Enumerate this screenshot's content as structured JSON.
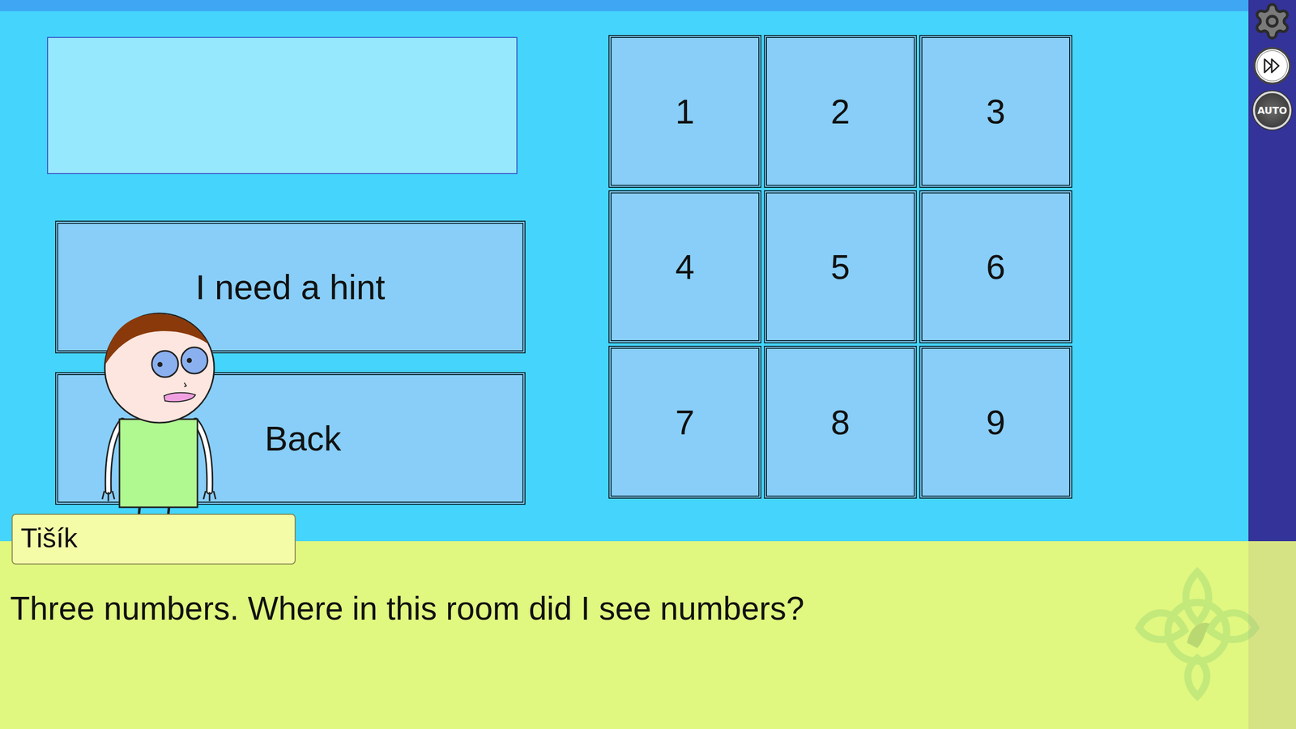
{
  "display": {
    "text": ""
  },
  "buttons": [
    "I need a hint",
    "Back"
  ],
  "keypad": [
    "1",
    "2",
    "3",
    "4",
    "5",
    "6",
    "7",
    "8",
    "9"
  ],
  "speaker": "Tišík",
  "dialogue": "Three numbers. Where in this room did I see numbers?",
  "quick_menu": [
    {
      "kind": "gear"
    },
    {
      "kind": "skip"
    },
    {
      "kind": "auto",
      "label": "AUTO"
    }
  ]
}
